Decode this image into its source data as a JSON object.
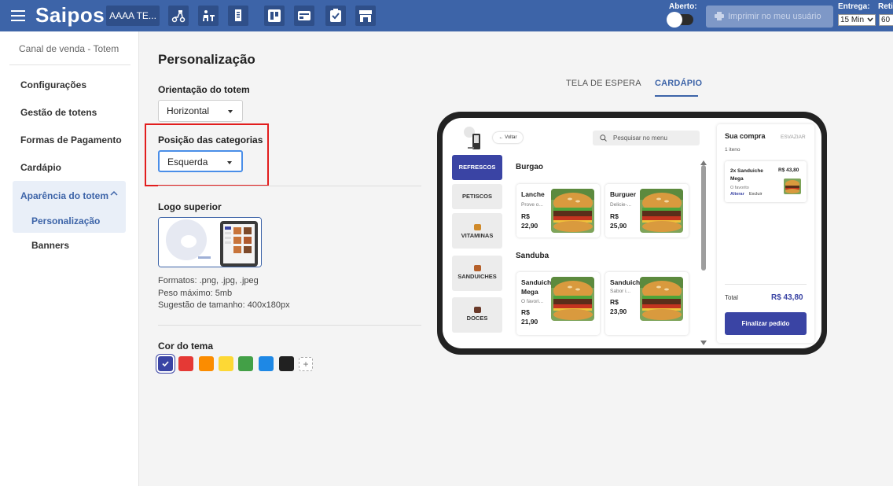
{
  "topbar": {
    "brand": "Saipos",
    "store_name": "AAAA TE...",
    "aberto_label": "Aberto:",
    "print_button": "Imprimir no meu usuário",
    "entrega_label": "Entrega:",
    "entrega_value": "15 Min",
    "retirada_label": "Retir",
    "retirada_value": "60",
    "icons": [
      "delivery-icon",
      "table-service-icon",
      "order-ticket-icon",
      "board-icon",
      "cashier-icon",
      "checklist-icon",
      "store-icon"
    ]
  },
  "sidebar": {
    "title": "Canal de venda - Totem",
    "items": [
      {
        "label": "Configurações"
      },
      {
        "label": "Gestão de totens"
      },
      {
        "label": "Formas de Pagamento"
      },
      {
        "label": "Cardápio"
      },
      {
        "label": "Aparência do totem"
      }
    ],
    "subitems": [
      {
        "label": "Personalização"
      },
      {
        "label": "Banners"
      }
    ]
  },
  "main": {
    "title": "Personalização",
    "orientacao": {
      "label": "Orientação do totem",
      "value": "Horizontal"
    },
    "posicao": {
      "label": "Posição das categorias",
      "value": "Esquerda"
    },
    "logo": {
      "label": "Logo superior",
      "formats": "Formatos: .png, .jpg, .jpeg",
      "weight": "Peso máximo: 5mb",
      "size": "Sugestão de tamanho: 400x180px"
    },
    "theme": {
      "label": "Cor do tema",
      "colors": [
        "#3a44a4",
        "#e53935",
        "#fb8c00",
        "#fdd835",
        "#43a047",
        "#1e88e5",
        "#212121"
      ],
      "selected": 0,
      "add": "+"
    },
    "tabs": [
      {
        "label": "TELA DE ESPERA",
        "active": false
      },
      {
        "label": "CARDÁPIO",
        "active": true
      }
    ]
  },
  "preview": {
    "back": "Voltar",
    "search_placeholder": "Pesquisar no menu",
    "categories": [
      "REFRESCOS",
      "PETISCOS",
      "VITAMINAS",
      "SANDUICHES",
      "DOCES"
    ],
    "sections": [
      {
        "title": "Burgao",
        "products": [
          {
            "name": "Lanche",
            "desc": "Prove o...",
            "price": "R$\n22,90"
          },
          {
            "name": "Burguer",
            "desc": "Delicie-...",
            "price": "R$\n25,90"
          }
        ]
      },
      {
        "title": "Sanduba",
        "products": [
          {
            "name": "Sanduich\nMega",
            "desc": "O favori...",
            "price": "R$\n21,90"
          },
          {
            "name": "Sanduich",
            "desc": "Sabor i...",
            "price": "R$\n23,90"
          }
        ]
      }
    ],
    "cart": {
      "title": "Sua compra",
      "empty_label": "ESVAZIAR",
      "count": "1 iteno",
      "item_name": "2x Sanduiche\nMega",
      "item_price": "R$ 43,80",
      "item_desc": "O favorito",
      "edit": "Alterar",
      "remove": "Excluir",
      "total_label": "Total",
      "total_value": "R$ 43,80",
      "finish": "Finalizar pedido"
    }
  }
}
